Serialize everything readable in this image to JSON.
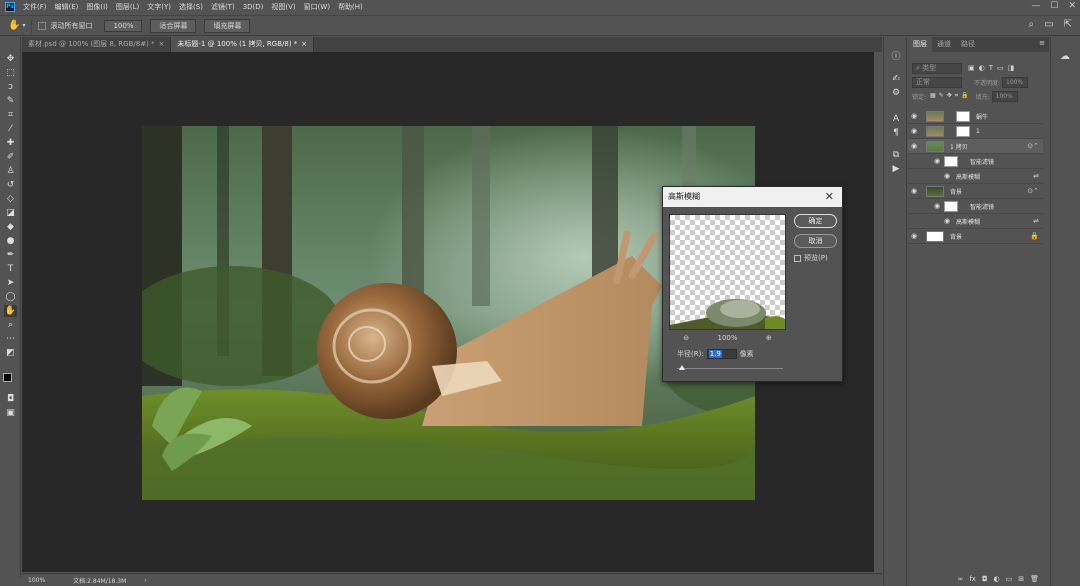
{
  "menubar": {
    "logo": "Ps",
    "items": [
      "文件(F)",
      "编辑(E)",
      "图像(I)",
      "图层(L)",
      "文字(Y)",
      "选择(S)",
      "滤镜(T)",
      "3D(D)",
      "视图(V)",
      "窗口(W)",
      "帮助(H)"
    ],
    "window_controls": [
      "—",
      "☐",
      "✕"
    ]
  },
  "options": {
    "scroll_all_label": "滚动所有窗口",
    "zoom_100": "100%",
    "fit_screen": "适合屏幕",
    "fill_screen": "填充屏幕"
  },
  "tabs": [
    {
      "label": "素材.psd @ 100% (图层 8, RGB/8#) *",
      "close": "×"
    },
    {
      "label": "未标题-1 @ 100% (1 拷贝, RGB/8) *",
      "close": "×"
    }
  ],
  "status": {
    "zoom": "100%",
    "doc": "文档:2.84M/18.3M",
    "arrow": "›"
  },
  "panel": {
    "tabs": [
      "图层",
      "通道",
      "路径"
    ],
    "kind_placeholder": "类型",
    "blend_mode": "正常",
    "opacity_label": "不透明度:",
    "opacity_value": "100%",
    "lock_label": "锁定:",
    "fill_label": "填充:",
    "fill_value": "100%",
    "layers": [
      {
        "name": "蜗牛",
        "eye": "👁"
      },
      {
        "name": "1",
        "eye": "👁"
      },
      {
        "name": "1 拷贝",
        "eye": "👁"
      },
      {
        "name": "智能滤镜",
        "eye": "👁"
      },
      {
        "name": "高斯模糊",
        "eye": "👁"
      },
      {
        "name": "背景",
        "eye": "👁"
      },
      {
        "name": "智能滤镜",
        "eye": "👁"
      },
      {
        "name": "高斯模糊",
        "eye": "👁"
      },
      {
        "name": "背景",
        "eye": "👁"
      }
    ]
  },
  "dialog": {
    "title": "高斯模糊",
    "close": "✕",
    "ok": "确定",
    "cancel": "取消",
    "preview_label": "预览(P)",
    "zoom_out": "⊖",
    "zoom_value": "100%",
    "zoom_in": "⊕",
    "radius_label": "半径(R):",
    "radius_value": "1.9",
    "radius_unit": "像素"
  },
  "colors": {
    "accent_blue": "#31a8ff",
    "ui_gray": "#535353",
    "workspace": "#282828"
  }
}
